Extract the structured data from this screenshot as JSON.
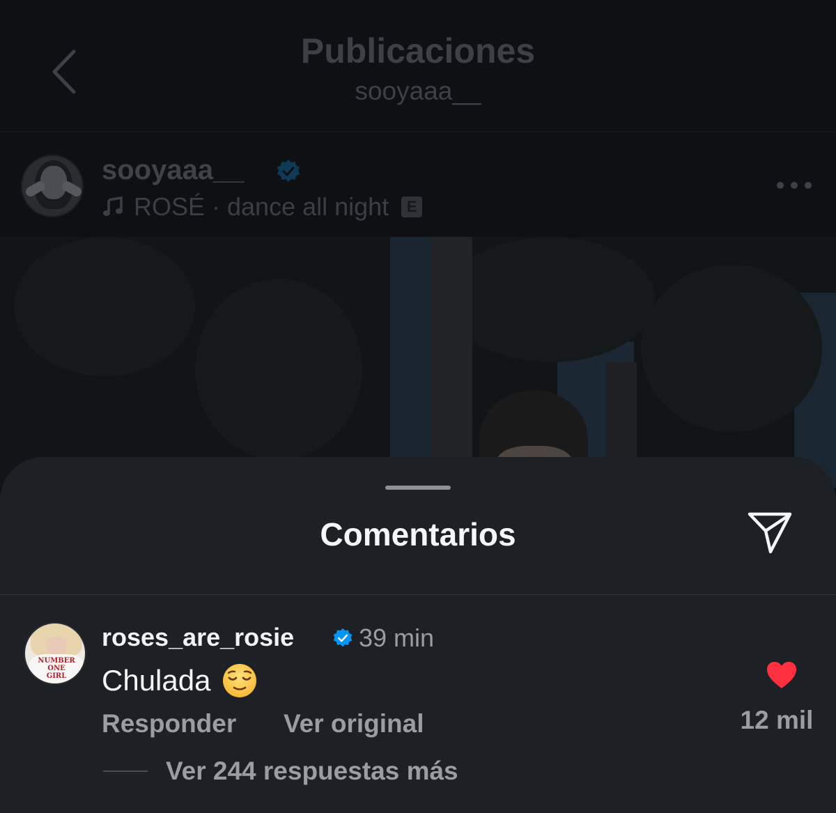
{
  "nav": {
    "title": "Publicaciones",
    "subtitle": "sooyaaa__"
  },
  "post": {
    "username": "sooyaaa__",
    "verified": true,
    "music": "ROSÉ · dance all night",
    "explicit_badge": "E"
  },
  "sheet": {
    "title": "Comentarios"
  },
  "comment": {
    "username": "roses_are_rosie",
    "verified": true,
    "time": "39 min",
    "text": "Chulada",
    "emoji": "relieved-face",
    "reply_label": "Responder",
    "original_label": "Ver original",
    "liked": true,
    "likes": "12 mil",
    "view_replies": "Ver 244 respuestas más",
    "avatar_shirt_text": "NUMBER ONE GIRL"
  },
  "colors": {
    "background": "#0f1114",
    "sheet": "#1d2024",
    "verified": "#0095f6",
    "like_red": "#ff3040",
    "secondary_text": "#9a9ea3"
  }
}
